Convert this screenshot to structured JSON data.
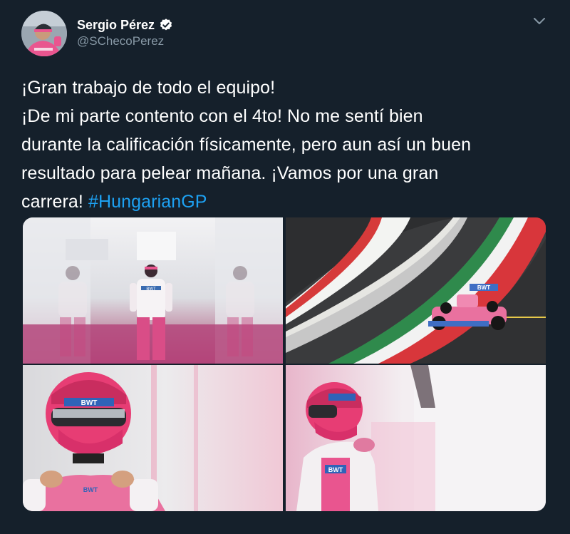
{
  "user": {
    "display_name": "Sergio Pérez",
    "handle": "@SChecoPerez",
    "verified": true
  },
  "tweet": {
    "lines": [
      "¡Gran trabajo de todo el equipo!",
      "¡De mi parte contento con el 4to! No me sentí bien",
      "durante la calificación físicamente, pero aun así un buen",
      "resultado para pelear mañana. ¡Vamos por una gran"
    ],
    "last_line_text": "carrera!",
    "hashtag": "#HungarianGP"
  },
  "images": {
    "photo1": {
      "sponsor_text": "BWT"
    },
    "photo2": {
      "car_text": "BWT"
    },
    "photo3": {
      "helmet_text": "BWT",
      "suit_text": "BWT"
    },
    "photo4": {
      "suit_text": "BWT"
    }
  },
  "colors": {
    "background": "#15202b",
    "text": "#ffffff",
    "secondary_text": "#8899a6",
    "hashtag": "#1da1f2",
    "verified_badge": "#ffffff",
    "team_pink": "#e9558f"
  },
  "icons": {
    "verified": "verified-badge-icon",
    "menu": "chevron-down-icon"
  }
}
